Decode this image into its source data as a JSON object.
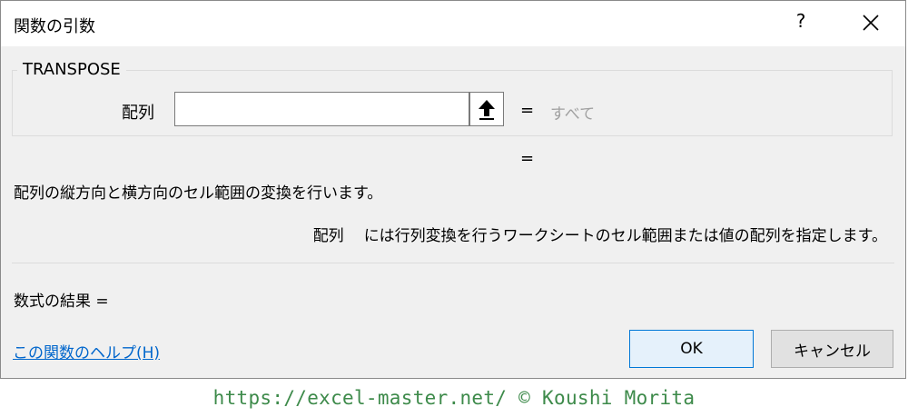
{
  "dialog": {
    "title": "関数の引数",
    "help_button": "?",
    "close_icon": "close-icon"
  },
  "function": {
    "name": "TRANSPOSE",
    "argument": {
      "label": "配列",
      "value": "",
      "equals": "=",
      "result_hint": "すべて"
    },
    "equals_result": "=",
    "description": "配列の縦方向と横方向のセル範囲の変換を行います。",
    "argument_description": {
      "name": "配列",
      "text": "には行列変換を行うワークシートのセル範囲または値の配列を指定します。"
    },
    "formula_result": "数式の結果 ="
  },
  "help_link": "この関数のヘルプ(H)",
  "buttons": {
    "ok": "OK",
    "cancel": "キャンセル"
  },
  "footer": "https://excel-master.net/  © Koushi Morita",
  "colors": {
    "dialog_bg": "#f0f0f0",
    "link": "#0066cc",
    "hint": "#a0a0a0",
    "ok_border": "#0078d7",
    "footer": "#3d8a4a"
  }
}
